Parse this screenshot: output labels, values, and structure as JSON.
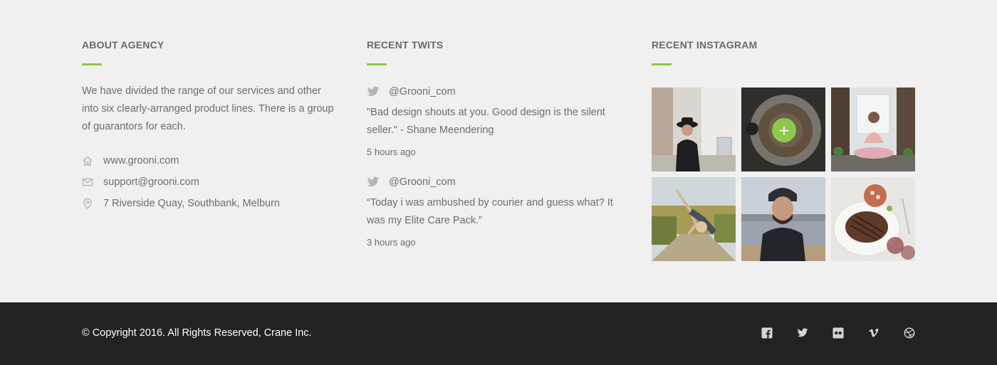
{
  "about": {
    "title": "ABOUT AGENCY",
    "text": "We have divided the range of our services and other into six  clearly-arranged product lines. There is a group of guarantors for each.",
    "contacts": [
      {
        "icon": "home-icon",
        "label": "www.grooni.com"
      },
      {
        "icon": "mail-icon",
        "label": "support@grooni.com"
      },
      {
        "icon": "location-pin-icon",
        "label": "7 Riverside Quay, Southbank, Melburn"
      }
    ]
  },
  "twits": {
    "title": "RECENT TWITS",
    "items": [
      {
        "handle": "@Grooni_com",
        "text": "\"Bad design shouts at you. Good design is the silent seller.\" - Shane Meendering",
        "time": "5 hours ago"
      },
      {
        "handle": "@Grooni_com",
        "text": "“Today i was ambushed by courier and guess what? It was my Elite Care Pack.”",
        "time": "3 hours ago"
      }
    ]
  },
  "instagram": {
    "title": "RECENT INSTAGRAM",
    "photos": [
      {
        "subject": "woman-in-hat-street"
      },
      {
        "subject": "coffee-cup",
        "hovered": true,
        "overlay_icon": "plus-icon"
      },
      {
        "subject": "woman-sitting-doorway"
      },
      {
        "subject": "girl-handstand-field"
      },
      {
        "subject": "man-beanie-pier"
      },
      {
        "subject": "steak-plate"
      }
    ]
  },
  "footer": {
    "copyright": "© Copyright 2016. All Rights Reserved, Crane Inc.",
    "social": [
      {
        "icon": "facebook-icon"
      },
      {
        "icon": "twitter-icon"
      },
      {
        "icon": "flickr-icon"
      },
      {
        "icon": "vimeo-icon"
      },
      {
        "icon": "dribbble-icon"
      }
    ]
  },
  "colors": {
    "accent": "#8cc84b",
    "background": "#f0f0f0",
    "footer_bar": "#222222",
    "text": "#6d6d6d"
  }
}
